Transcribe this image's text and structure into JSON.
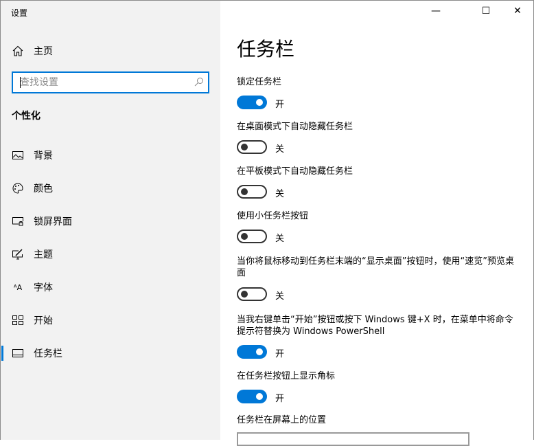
{
  "window": {
    "title": "设置",
    "minimize": "—",
    "maximize": "☐",
    "close": "✕"
  },
  "sidebar": {
    "home": "主页",
    "search": {
      "placeholder": "查找设置",
      "value": ""
    },
    "section": "个性化",
    "items": [
      {
        "label": "背景",
        "icon": "image-icon"
      },
      {
        "label": "颜色",
        "icon": "palette-icon"
      },
      {
        "label": "锁屏界面",
        "icon": "lock-screen-icon"
      },
      {
        "label": "主题",
        "icon": "theme-icon"
      },
      {
        "label": "字体",
        "icon": "font-icon"
      },
      {
        "label": "开始",
        "icon": "start-icon"
      },
      {
        "label": "任务栏",
        "icon": "taskbar-icon",
        "active": true
      }
    ]
  },
  "main": {
    "title": "任务栏",
    "settings": [
      {
        "label": "锁定任务栏",
        "on": true,
        "state": "开"
      },
      {
        "label": "在桌面模式下自动隐藏任务栏",
        "on": false,
        "state": "关"
      },
      {
        "label": "在平板模式下自动隐藏任务栏",
        "on": false,
        "state": "关"
      },
      {
        "label": "使用小任务栏按钮",
        "on": false,
        "state": "关"
      },
      {
        "label": "当你将鼠标移动到任务栏末端的“显示桌面”按钮时，使用“速览”预览桌面",
        "on": false,
        "state": "关"
      },
      {
        "label": "当我右键单击“开始”按钮或按下 Windows 键+X 时，在菜单中将命令提示符替换为 Windows PowerShell",
        "on": true,
        "state": "开"
      },
      {
        "label": "在任务栏按钮上显示角标",
        "on": true,
        "state": "开"
      }
    ],
    "position_label": "任务栏在屏幕上的位置"
  },
  "colors": {
    "accent": "#0078d7",
    "sidebar_bg": "#f2f2f2"
  }
}
